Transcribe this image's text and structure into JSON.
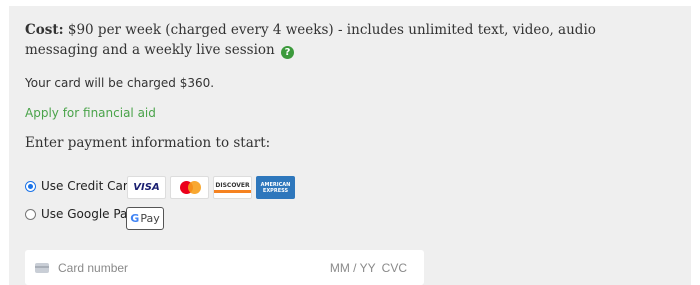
{
  "cost": {
    "label": "Cost:",
    "text": " $90 per week (charged every 4 weeks) - includes unlimited text, video, audio messaging and a weekly live session",
    "help_icon_glyph": "?"
  },
  "charge_notice": "Your card will be charged $360.",
  "financial_aid_link": "Apply for financial aid",
  "payment_heading": "Enter payment information to start:",
  "payment_methods": {
    "credit_card_label": "Use Credit Card",
    "google_pay_label": "Use Google Pay",
    "selected": "credit_card"
  },
  "card_brands": {
    "visa": "VISA",
    "discover": "DISCOVER",
    "amex": "AMERICAN EXPRESS"
  },
  "google_pay_button": {
    "g": "G",
    "text": "Pay"
  },
  "card_form": {
    "card_number_placeholder": "Card number",
    "expiry_placeholder": "MM / YY",
    "cvc_placeholder": "CVC"
  },
  "colors": {
    "panel_bg": "#efefef",
    "link_green": "#4aa34a",
    "help_green": "#3c9a3c",
    "radio_blue": "#1a73e8"
  }
}
